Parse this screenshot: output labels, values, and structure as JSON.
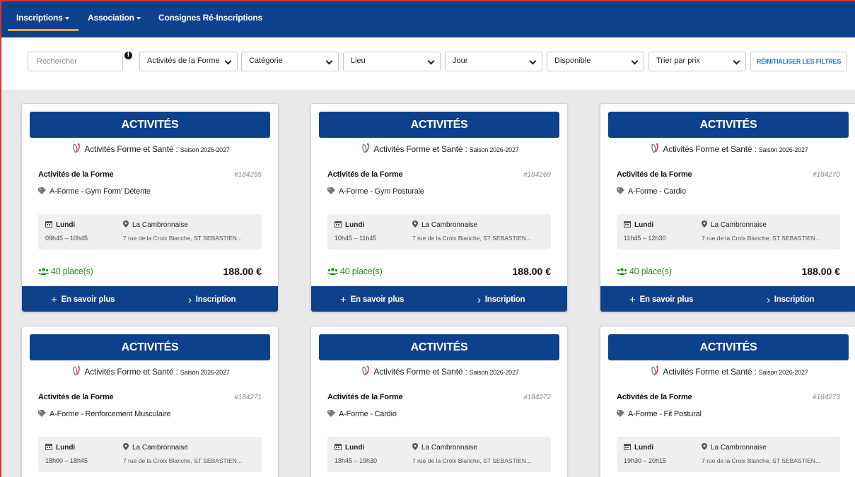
{
  "nav": {
    "items": [
      {
        "label": "Inscriptions",
        "caret": true
      },
      {
        "label": "Association",
        "caret": true
      },
      {
        "label": "Consignes Ré-Inscriptions",
        "caret": false
      }
    ]
  },
  "filters": {
    "search_placeholder": "Rechercher",
    "selects": [
      "Activités de la Forme",
      "Catégorie",
      "Lieu",
      "Jour",
      "Disponible",
      "Trier par prix"
    ],
    "reset_label": "RÉINITIALISER LES FILTRES"
  },
  "cards": [
    {
      "header": "ACTIVITÉS",
      "org": "Activités Forme et Santé",
      "season": "Saison 2026-2027",
      "category": "Activités de la Forme",
      "id": "#184255",
      "activity": "A-Forme - Gym Form' Détente",
      "day": "Lundi",
      "time": "09h45 – 10h45",
      "place": "La Cambronnaise",
      "address": "7 rue de la Croix Blanche, ST SEBASTIEN...",
      "places": "40 place(s)",
      "price": "188.00 €",
      "more": "En savoir plus",
      "signup": "Inscription"
    },
    {
      "header": "ACTIVITÉS",
      "org": "Activités Forme et Santé",
      "season": "Saison 2026-2027",
      "category": "Activités de la Forme",
      "id": "#184269",
      "activity": "A-Forme - Gym Posturale",
      "day": "Lundi",
      "time": "10h45 – 11h45",
      "place": "La Cambronnaise",
      "address": "7 rue de la Croix Blanche, ST SEBASTIEN...",
      "places": "40 place(s)",
      "price": "188.00 €",
      "more": "En savoir plus",
      "signup": "Inscription"
    },
    {
      "header": "ACTIVITÉS",
      "org": "Activités Forme et Santé",
      "season": "Saison 2026-2027",
      "category": "Activités de la Forme",
      "id": "#184270",
      "activity": "A-Forme - Cardio",
      "day": "Lundi",
      "time": "11h45 – 12h30",
      "place": "La Cambronnaise",
      "address": "7 rue de la Croix Blanche, ST SEBASTIEN...",
      "places": "40 place(s)",
      "price": "188.00 €",
      "more": "En savoir plus",
      "signup": "Inscription"
    },
    {
      "header": "ACTIVITÉS",
      "org": "Activités Forme et Santé",
      "season": "Saison 2026-2027",
      "category": "Activités de la Forme",
      "id": "#184271",
      "activity": "A-Forme - Renforcement Musculaire",
      "day": "Lundi",
      "time": "18h00 – 18h45",
      "place": "La Cambronnaise",
      "address": "7 rue de la Croix Blanche, ST SEBASTIEN...",
      "places": "",
      "price": "",
      "more": "",
      "signup": ""
    },
    {
      "header": "ACTIVITÉS",
      "org": "Activités Forme et Santé",
      "season": "Saison 2026-2027",
      "category": "Activités de la Forme",
      "id": "#184272",
      "activity": "A-Forme - Cardio",
      "day": "Lundi",
      "time": "18h45 – 19h30",
      "place": "La Cambronnaise",
      "address": "7 rue de la Croix Blanche, ST SEBASTIEN...",
      "places": "",
      "price": "",
      "more": "",
      "signup": ""
    },
    {
      "header": "ACTIVITÉS",
      "org": "Activités Forme et Santé",
      "season": "Saison 2026-2027",
      "category": "Activités de la Forme",
      "id": "#184273",
      "activity": "A-Forme - Fit Postural",
      "day": "Lundi",
      "time": "19h30 – 20h15",
      "place": "La Cambronnaise",
      "address": "7 rue de la Croix Blanche, ST SEBASTIEN...",
      "places": "",
      "price": "",
      "more": "",
      "signup": ""
    }
  ],
  "colors": {
    "brand": "#0e418c",
    "accent": "#f0a23a",
    "available": "#2a8a2a",
    "link": "#1a78d6"
  }
}
